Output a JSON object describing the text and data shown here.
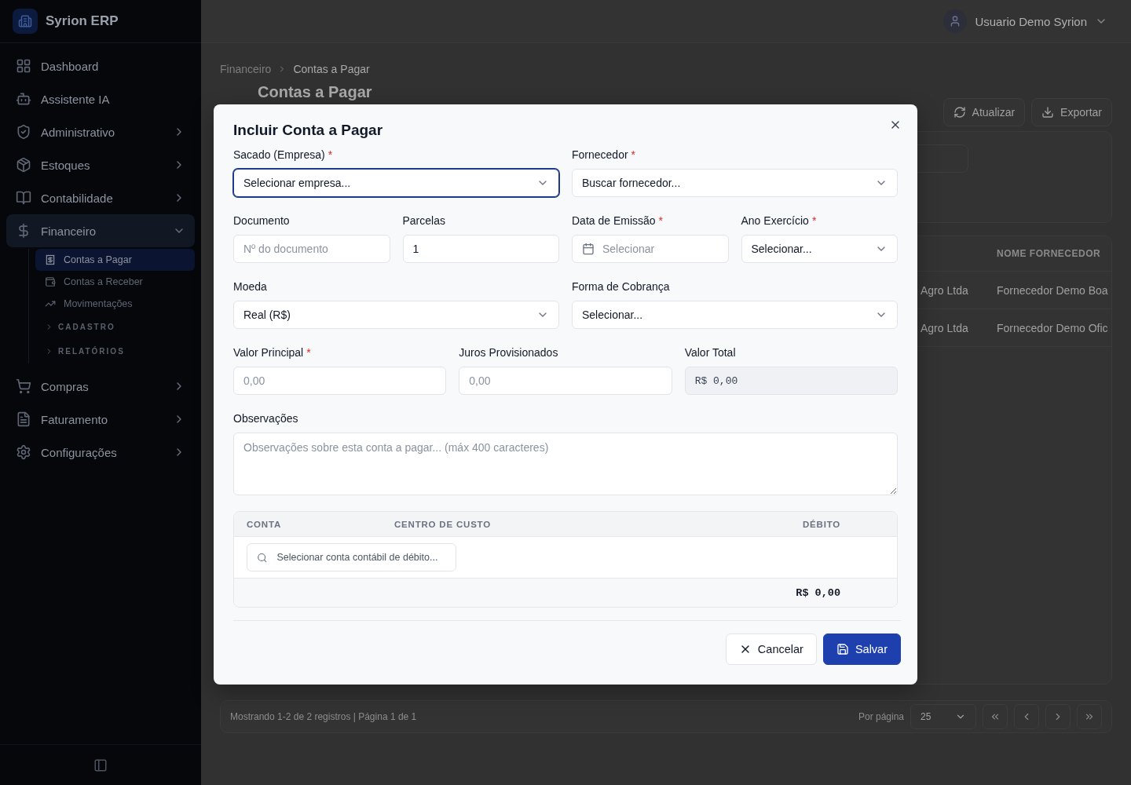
{
  "app": {
    "name": "Syrion ERP"
  },
  "sidebar": {
    "items": [
      {
        "label": "Dashboard",
        "selected": false
      },
      {
        "label": "Assistente IA",
        "selected": false
      },
      {
        "label": "Administrativo",
        "expanded": false,
        "selected": false
      },
      {
        "label": "Estoques",
        "expanded": false,
        "selected": false
      },
      {
        "label": "Contabilidade",
        "expanded": false,
        "selected": false
      },
      {
        "label": "Financeiro",
        "expanded": true,
        "selected": true,
        "children": [
          {
            "kind": "link",
            "label": "Contas a Pagar",
            "selected": true
          },
          {
            "kind": "link",
            "label": "Contas a Receber",
            "selected": false
          },
          {
            "kind": "link",
            "label": "Movimentações",
            "selected": false
          },
          {
            "kind": "section",
            "label": "CADASTRO",
            "expanded": false
          },
          {
            "kind": "section",
            "label": "RELATÓRIOS",
            "expanded": false
          }
        ]
      },
      {
        "label": "Compras",
        "expanded": false,
        "selected": false
      },
      {
        "label": "Faturamento",
        "expanded": false,
        "selected": false
      },
      {
        "label": "Configurações",
        "expanded": false,
        "selected": false
      }
    ]
  },
  "header": {
    "user": "Usuario Demo Syrion"
  },
  "breadcrumb": [
    "Financeiro",
    "Contas a Pagar"
  ],
  "page": {
    "title": "Contas a Pagar",
    "actions": [
      "Atualizar",
      "Exportar"
    ]
  },
  "table": {
    "columns": [
      "",
      "NOME FORNECEDOR"
    ],
    "rows": [
      [
        "Agro Ltda",
        "Fornecedor Demo Boa"
      ],
      [
        "Agro Ltda",
        "Fornecedor Demo Ofic"
      ]
    ]
  },
  "footer": {
    "summary": "Mostrando 1-2 de 2 registros | Página 1 de 1",
    "per_page_label": "Por página",
    "per_page": "25"
  },
  "dialog": {
    "title": "Incluir Conta a Pagar",
    "fields": [
      {
        "kind": "select",
        "label": "Sacado (Empresa)",
        "required_mark": "*",
        "value": "Selecionar empresa...",
        "focused": true
      },
      {
        "kind": "select",
        "label": "Fornecedor",
        "required_mark": "*",
        "value": "Buscar fornecedor...",
        "focused": false
      },
      {
        "kind": "input",
        "label": "Documento",
        "placeholder": "Nº do documento",
        "focused": false
      },
      {
        "kind": "input",
        "label": "Parcelas",
        "value": "1",
        "focused": false
      },
      {
        "kind": "date",
        "label": "Data de Emissão",
        "required_mark": "*",
        "placeholder": "Selecionar",
        "focused": false
      },
      {
        "kind": "select",
        "label": "Ano Exercício",
        "required_mark": "*",
        "value": "Selecionar...",
        "focused": false
      },
      {
        "kind": "select",
        "label": "Moeda",
        "value": "Real (R$)",
        "focused": false
      },
      {
        "kind": "select",
        "label": "Forma de Cobrança",
        "value": "Selecionar...",
        "focused": false
      },
      {
        "kind": "input",
        "label": "Valor Principal",
        "required_mark": "*",
        "placeholder": "0,00",
        "focused": false
      },
      {
        "kind": "input",
        "label": "Juros Provisionados",
        "placeholder": "0,00",
        "focused": false
      },
      {
        "kind": "readonly",
        "label": "Valor Total",
        "value": "R$ 0,00",
        "focused": false
      }
    ],
    "notes": {
      "label": "Observações",
      "placeholder": "Observações sobre esta conta a pagar... (máx 400 caracteres)"
    },
    "entries": {
      "columns": [
        "CONTA",
        "CENTRO DE CUSTO",
        "DÉBITO"
      ],
      "search_placeholder": "Selecionar conta contábil de débito...",
      "total": "R$ 0,00"
    },
    "buttons": [
      {
        "kind": "secondary",
        "label": "Cancelar"
      },
      {
        "kind": "primary",
        "label": "Salvar"
      }
    ]
  }
}
